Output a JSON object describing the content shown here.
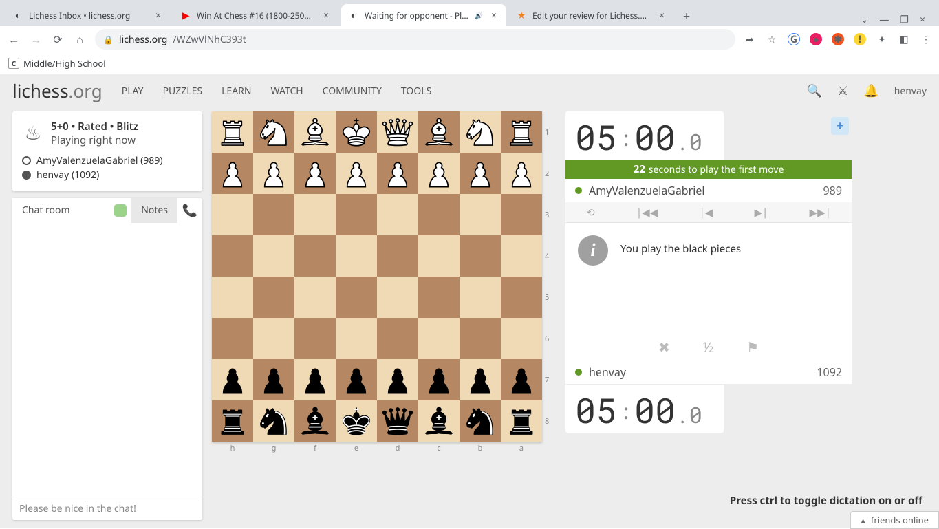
{
  "browser": {
    "tabs": [
      {
        "title": "Lichess Inbox • lichess.org",
        "favicon": "◐"
      },
      {
        "title": "Win At Chess #16 (1800-2500) -",
        "favicon": "▶"
      },
      {
        "title": "Waiting for opponent - Play A",
        "favicon": "◐",
        "active": true,
        "audio": true
      },
      {
        "title": "Edit your review for Lichess.org",
        "favicon": "★"
      }
    ],
    "url_host": "lichess.org",
    "url_path": "/WZwVlNhC393t",
    "bookmark": "Middle/High School"
  },
  "nav": {
    "logo_main": "lichess",
    "logo_suffix": ".org",
    "items": [
      "PLAY",
      "PUZZLES",
      "LEARN",
      "WATCH",
      "COMMUNITY",
      "TOOLS"
    ],
    "username": "henvay"
  },
  "game_meta": {
    "line1": "5+0 • Rated • Blitz",
    "line2": "Playing right now",
    "white_player": "AmyValenzuelaGabriel (989)",
    "black_player": "henvay (1092)"
  },
  "chat": {
    "tab_room": "Chat room",
    "tab_notes": "Notes",
    "placeholder": "Please be nice in the chat!"
  },
  "board": {
    "files": [
      "h",
      "g",
      "f",
      "e",
      "d",
      "c",
      "b",
      "a"
    ],
    "ranks": [
      "1",
      "2",
      "3",
      "4",
      "5",
      "6",
      "7",
      "8"
    ]
  },
  "clocks": {
    "top_min": "05",
    "top_sec": "00",
    "top_tenths": "0",
    "bot_min": "05",
    "bot_sec": "00",
    "bot_tenths": "0"
  },
  "firstmove": {
    "seconds": "22",
    "text": "seconds to play the first move"
  },
  "opponent": {
    "name": "AmyValenzuelaGabriel",
    "rating": "989"
  },
  "me": {
    "name": "henvay",
    "rating": "1092"
  },
  "info_msg": "You play the black pieces",
  "half": "½",
  "dictation": "Press ctrl to toggle dictation on or off",
  "friends": "friends online"
}
